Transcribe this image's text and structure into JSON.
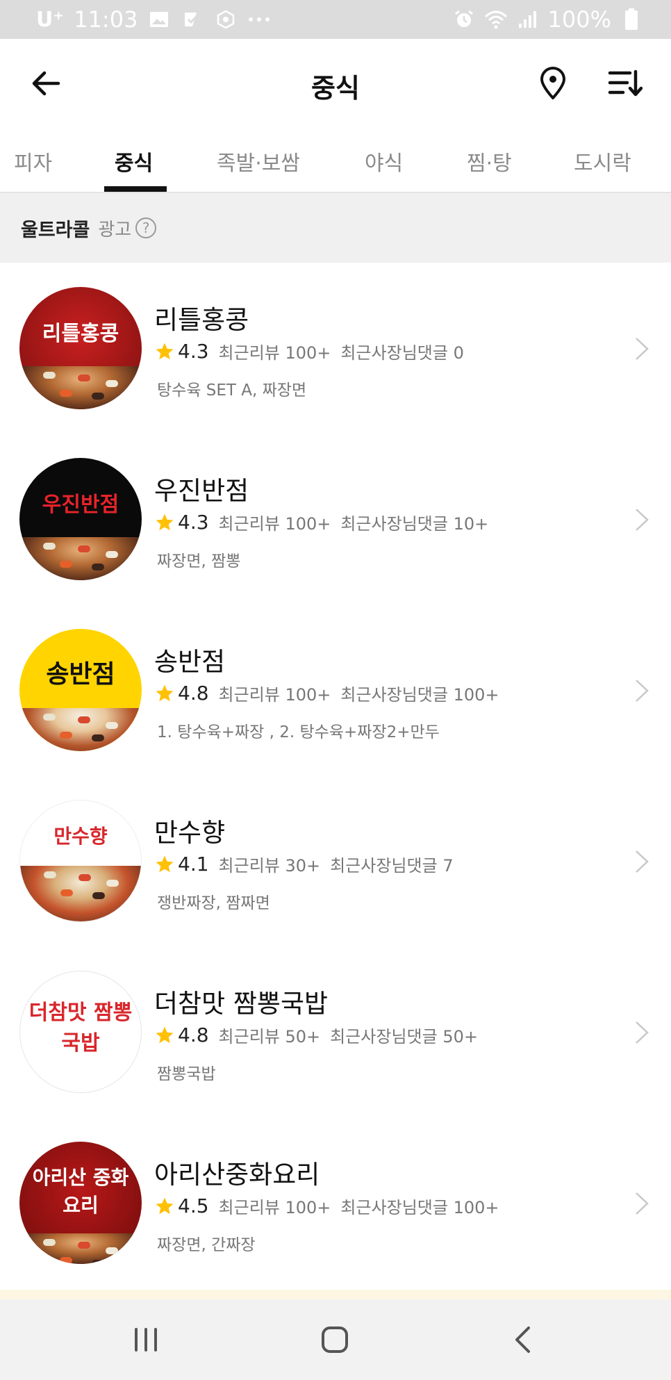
{
  "status_bar": {
    "carrier": "U⁺",
    "time": "11:03",
    "battery": "100%",
    "left_icons": [
      "image-icon",
      "check-icon",
      "snowflake-icon",
      "more-dots-icon"
    ],
    "right_icons": [
      "alarm-icon",
      "wifi-icon",
      "signal-icon",
      "battery-icon"
    ]
  },
  "header": {
    "title": "중식",
    "back_icon": "arrow-left-icon",
    "location_icon": "location-pin-icon",
    "sort_icon": "sort-icon"
  },
  "tabs": [
    {
      "label": "피자",
      "active": false
    },
    {
      "label": "중식",
      "active": true
    },
    {
      "label": "족발·보쌈",
      "active": false
    },
    {
      "label": "야식",
      "active": false
    },
    {
      "label": "찜·탕",
      "active": false
    },
    {
      "label": "도시락",
      "active": false
    }
  ],
  "section": {
    "title": "울트라콜",
    "ad_label": "광고",
    "help_glyph": "?"
  },
  "stores": [
    {
      "logo_text": "리틀홍콩",
      "name": "리틀홍콩",
      "rating": "4.3",
      "reviews": "최근리뷰 100+",
      "owner_replies": "최근사장님댓글 0",
      "menu": "탕수육 SET A, 짜장면",
      "colors": {
        "bg": "#9e1a1a",
        "text": "#ffffff"
      }
    },
    {
      "logo_text": "우진반점",
      "name": "우진반점",
      "rating": "4.3",
      "reviews": "최근리뷰 100+",
      "owner_replies": "최근사장님댓글 10+",
      "menu": "짜장면, 짬뽕",
      "colors": {
        "bg": "#0a0a0a",
        "text": "#e8232a"
      }
    },
    {
      "logo_text": "송반점",
      "name": "송반점",
      "rating": "4.8",
      "reviews": "최근리뷰 100+",
      "owner_replies": "최근사장님댓글 100+",
      "menu": "1. 탕수육+짜장 , 2. 탕수육+짜장2+만두",
      "colors": {
        "bg": "#ffd400",
        "text": "#111111"
      }
    },
    {
      "logo_text": "만수향",
      "name": "만수향",
      "rating": "4.1",
      "reviews": "최근리뷰 30+",
      "owner_replies": "최근사장님댓글 7",
      "menu": "쟁반짜장, 짬짜면",
      "colors": {
        "bg": "#ffffff",
        "text": "#d8262b"
      }
    },
    {
      "logo_text": "더참맛 짬뽕국밥",
      "name": "더참맛 짬뽕국밥",
      "rating": "4.8",
      "reviews": "최근리뷰 50+",
      "owner_replies": "최근사장님댓글 50+",
      "menu": "짬뽕국밥",
      "colors": {
        "bg": "#ffffff",
        "text": "#d8262b"
      }
    },
    {
      "logo_text": "아리산 중화요리",
      "name": "아리산중화요리",
      "rating": "4.5",
      "reviews": "최근리뷰 100+",
      "owner_replies": "최근사장님댓글 100+",
      "menu": "짜장면, 간짜장",
      "colors": {
        "bg": "#8c1212",
        "text": "#ffffff"
      }
    }
  ],
  "nav_bar": {
    "icons": [
      "recent-apps-icon",
      "home-icon",
      "nav-back-icon"
    ]
  },
  "colors": {
    "star": "#ffc107",
    "accent_underline": "#111111",
    "section_bg": "#f0f0f0",
    "status_bar_bg": "#dcdcdc"
  }
}
